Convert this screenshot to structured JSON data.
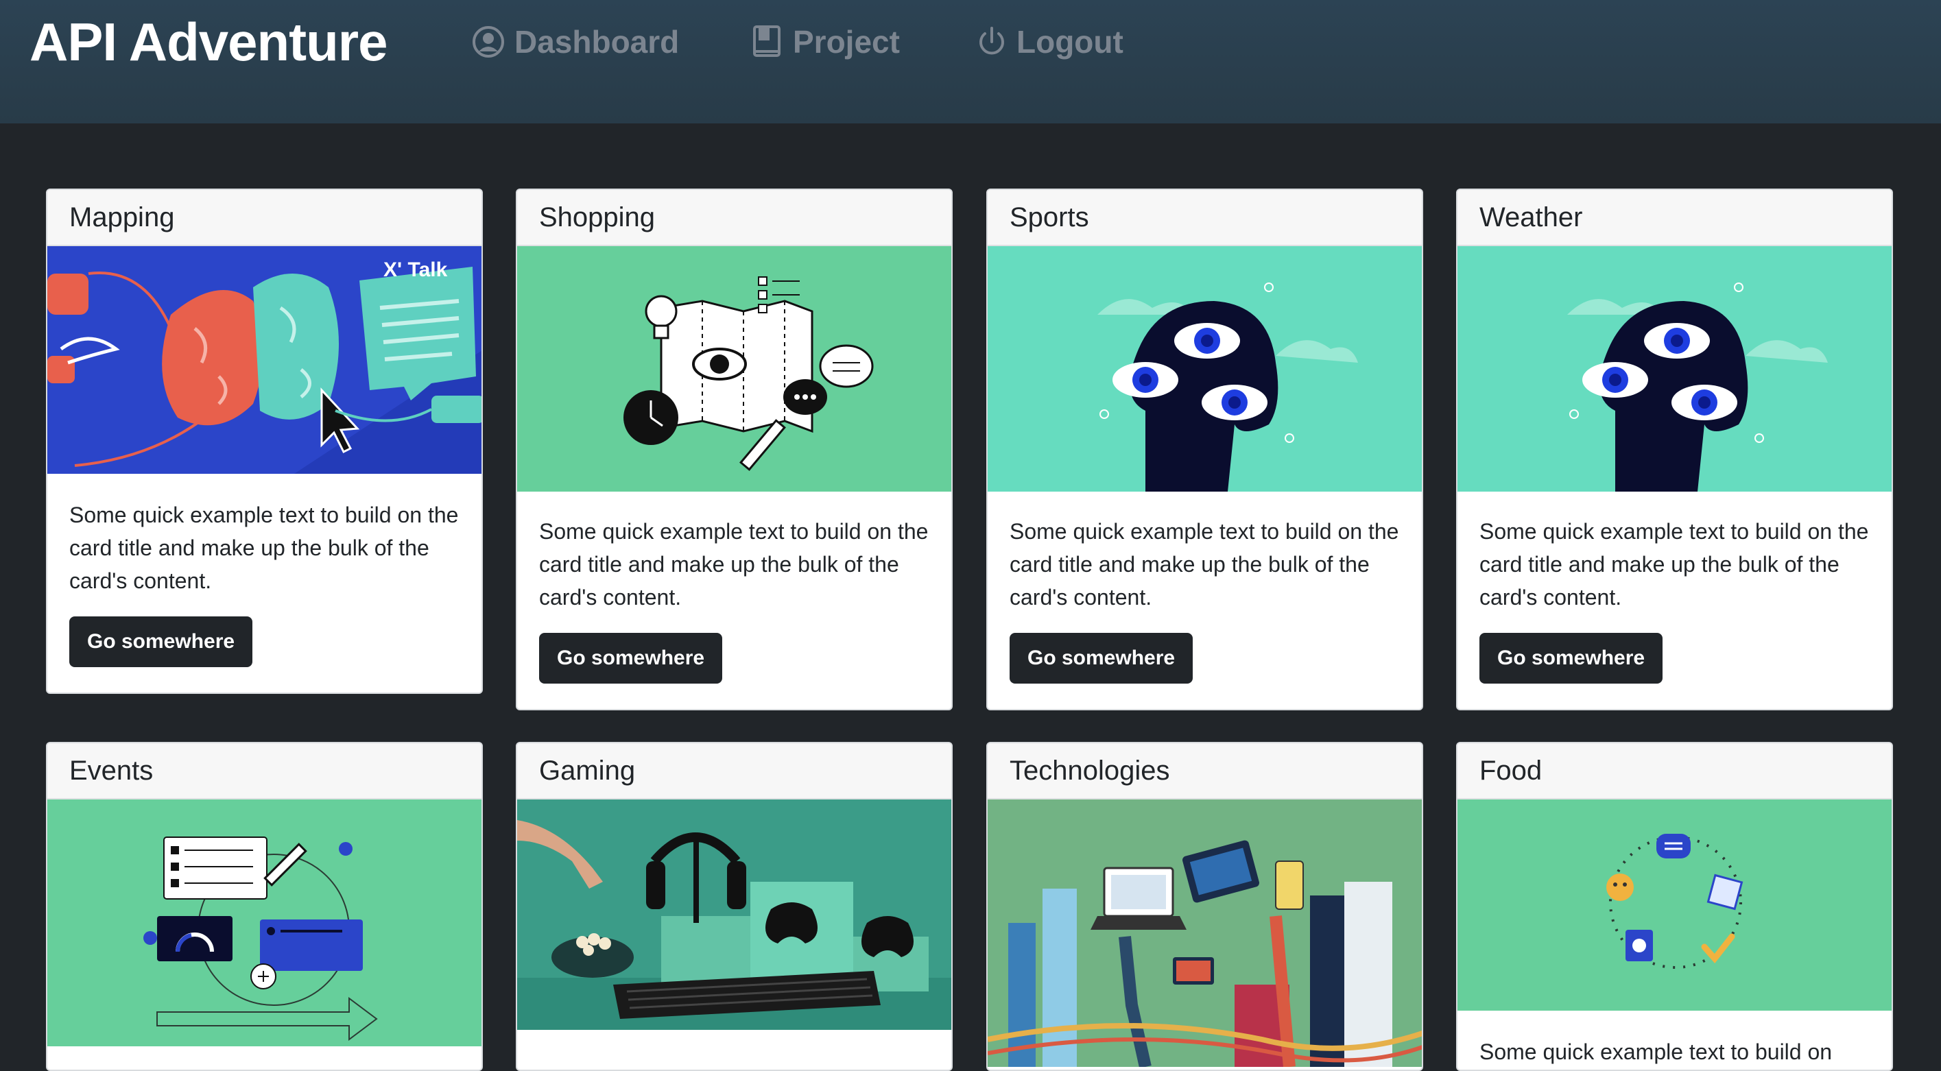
{
  "app": {
    "brand": "API Adventure"
  },
  "nav": {
    "items": [
      {
        "label": "Dashboard",
        "icon": "user-circle-icon"
      },
      {
        "label": "Project",
        "icon": "book-icon"
      },
      {
        "label": "Logout",
        "icon": "power-icon"
      }
    ]
  },
  "cards": [
    {
      "title": "Mapping",
      "text": "Some quick example text to build on the card title and make up the bulk of the card's content.",
      "button": "Go somewhere",
      "image_caption": "X' Talk"
    },
    {
      "title": "Shopping",
      "text": "Some quick example text to build on the card title and make up the bulk of the card's content.",
      "button": "Go somewhere"
    },
    {
      "title": "Sports",
      "text": "Some quick example text to build on the card title and make up the bulk of the card's content.",
      "button": "Go somewhere"
    },
    {
      "title": "Weather",
      "text": "Some quick example text to build on the card title and make up the bulk of the card's content.",
      "button": "Go somewhere"
    },
    {
      "title": "Events",
      "text": "",
      "button": ""
    },
    {
      "title": "Gaming",
      "text": "",
      "button": ""
    },
    {
      "title": "Technologies",
      "text": "",
      "button": ""
    },
    {
      "title": "Food",
      "text": "Some quick example text to build on",
      "button": ""
    }
  ],
  "colors": {
    "navbar": "#2c4354",
    "page_background": "#212529",
    "button": "#212529",
    "illustration_green": "#66cf9b",
    "illustration_blue": "#2b45c9"
  }
}
